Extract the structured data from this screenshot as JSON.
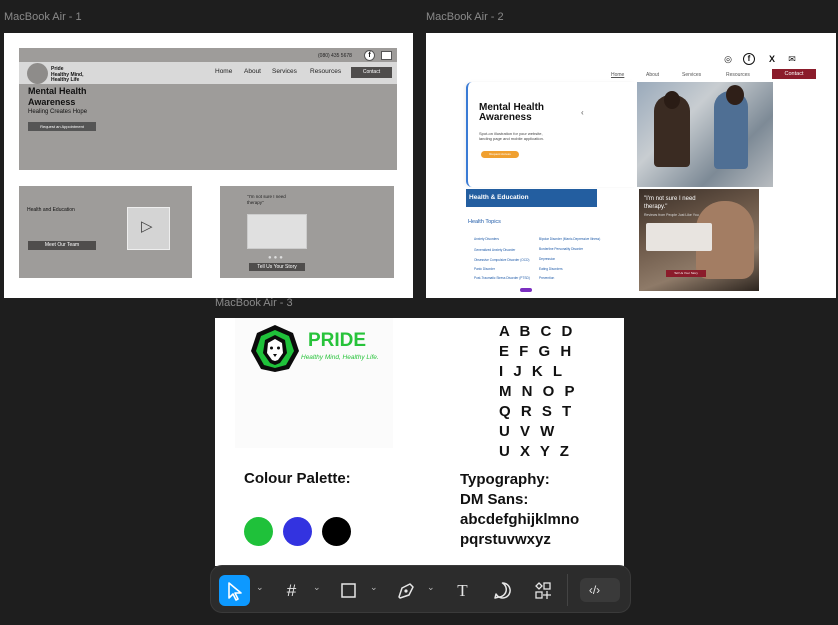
{
  "frames": {
    "f1": {
      "label": "MacBook Air - 1"
    },
    "f2": {
      "label": "MacBook Air - 2"
    },
    "f3": {
      "label": "MacBook Air - 3"
    }
  },
  "wireframe": {
    "phone": "(080) 435 5678",
    "brand_lines": [
      "Pride",
      "Healthy Mind,",
      "Healthy Life"
    ],
    "nav": [
      "Home",
      "About",
      "Services",
      "Resources"
    ],
    "contact": "Contact",
    "hero_title_lines": [
      "Mental Health",
      "Awareness"
    ],
    "hero_tagline": "Healing Creates Hope",
    "request_button": "Request an Appointment",
    "card1_text": "Health and Education",
    "card1_button": "Meet Our Team",
    "card2_quote_lines": [
      "\"I'm not sure I need",
      "therapy\""
    ],
    "card2_button": "Tell Us Your Story",
    "facebook_glyph": "f"
  },
  "landing": {
    "nav": [
      "Home",
      "About",
      "Services",
      "Resources"
    ],
    "contact": "Contact",
    "hero_title_lines": [
      "Mental Health",
      "Awareness"
    ],
    "hero_sub_lines": [
      "Spot-on illustration for your website,",
      "landing page and mobile application."
    ],
    "hero_button": "Request Access",
    "health_header": "Health & Education",
    "health_topics_title": "Health Topics",
    "topics_left": [
      "Anxiety Disorders",
      "Generalized Anxiety Disorder",
      "Obsessive Compulsive Disorder (OCD)",
      "Panic Disorder",
      "Post-Traumatic Stress Disorder (PTSD)"
    ],
    "topics_right": [
      "Bipolar Disorder (Manic-Depressive Illness)",
      "Borderline Personality Disorder",
      "Depression",
      "Eating Disorders",
      "Prevention"
    ],
    "quote_lines": [
      "\"I'm not sure I need",
      "therapy.\""
    ],
    "quote_sub": "Reviews from People Just Like You",
    "story_button": "Tell Us Your Story",
    "icons": [
      "instagram-icon",
      "facebook-icon",
      "x-icon",
      "mail-icon"
    ]
  },
  "styleguide": {
    "brand_name": "PRIDE",
    "slogan": "Healthy Mind, Healthy Life.",
    "alphabet_lines": [
      "A B C D",
      "E F G H",
      "I J K L",
      "M N O P",
      "Q R S T",
      "U V W",
      "U X Y Z"
    ],
    "palette_label": "Colour Palette:",
    "palette": [
      "#1fc13a",
      "#3333e0",
      "#000000"
    ],
    "typography_lines": [
      "Typography:",
      "DM Sans:",
      "abcdefghijklmno",
      "pqrstuvwxyz"
    ]
  },
  "toolbar": {
    "tools": [
      "move-tool",
      "frame-tool",
      "rectangle-tool",
      "pen-tool",
      "text-tool",
      "comment-tool",
      "assets-tool",
      "dev-mode-toggle"
    ],
    "active": "move-tool"
  }
}
